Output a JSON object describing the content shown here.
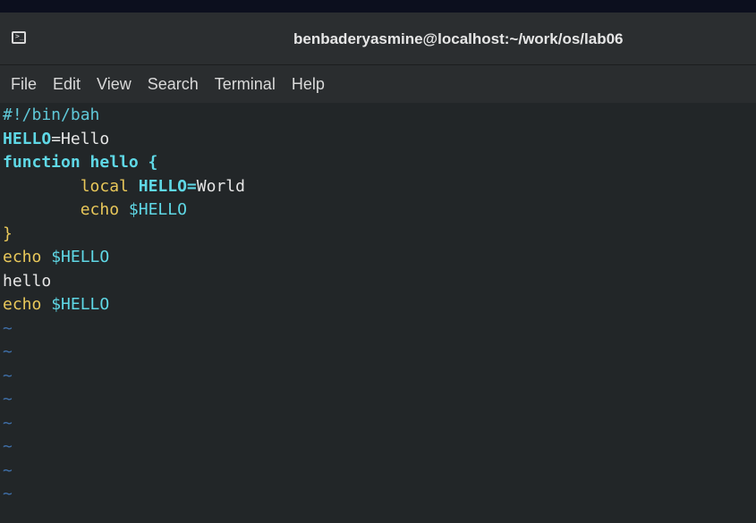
{
  "window": {
    "title": "benbaderyasmine@localhost:~/work/os/lab06",
    "icon": "terminal-icon"
  },
  "menu": {
    "items": [
      "File",
      "Edit",
      "View",
      "Search",
      "Terminal",
      "Help"
    ]
  },
  "editor": {
    "lines": [
      {
        "tokens": [
          {
            "t": "#!/bin/bah",
            "c": "comment"
          }
        ]
      },
      {
        "tokens": [
          {
            "t": "HELLO",
            "c": "var"
          },
          {
            "t": "=Hello",
            "c": "plain"
          }
        ]
      },
      {
        "tokens": [
          {
            "t": "function hello {",
            "c": "kw"
          }
        ]
      },
      {
        "tokens": [
          {
            "t": "        ",
            "c": "plain"
          },
          {
            "t": "local ",
            "c": "local"
          },
          {
            "t": "HELLO=",
            "c": "var"
          },
          {
            "t": "World",
            "c": "plain"
          }
        ]
      },
      {
        "tokens": [
          {
            "t": "        ",
            "c": "plain"
          },
          {
            "t": "echo ",
            "c": "builtin"
          },
          {
            "t": "$HELLO",
            "c": "dollar"
          }
        ]
      },
      {
        "tokens": [
          {
            "t": "}",
            "c": "brace"
          }
        ]
      },
      {
        "tokens": [
          {
            "t": "echo ",
            "c": "builtin"
          },
          {
            "t": "$HELLO",
            "c": "dollar"
          }
        ]
      },
      {
        "tokens": [
          {
            "t": "hello",
            "c": "plain"
          }
        ]
      },
      {
        "tokens": [
          {
            "t": "echo ",
            "c": "builtin"
          },
          {
            "t": "$HELLO",
            "c": "dollar"
          }
        ]
      }
    ],
    "empty_marker": "~",
    "empty_lines": 8
  },
  "colors": {
    "comment": "#5fc8d8",
    "keyword": "#5fd8e6",
    "builtin": "#e9c85a",
    "tilde": "#3f6fa8",
    "background": "#222628"
  }
}
